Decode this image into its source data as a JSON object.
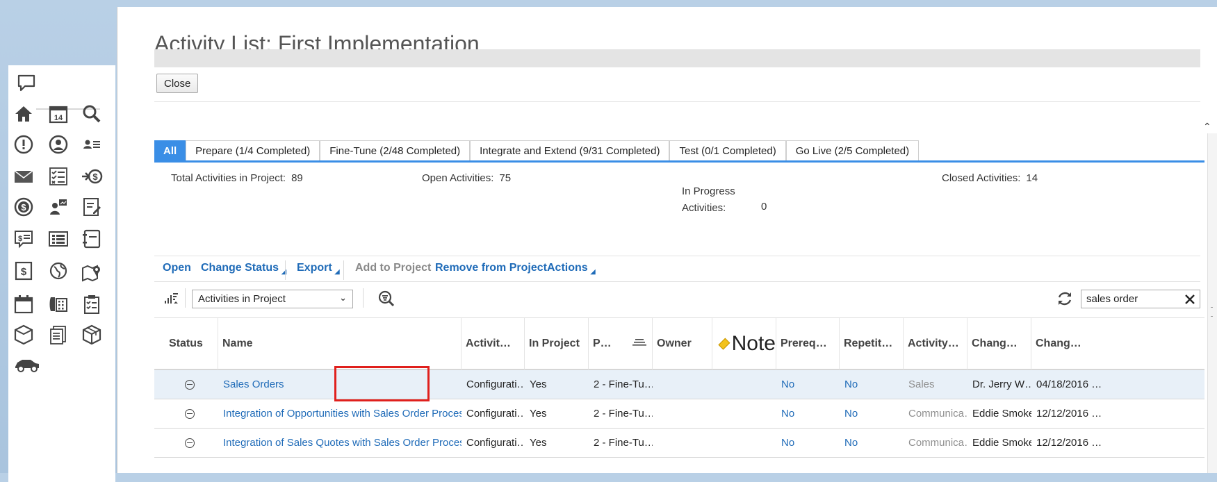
{
  "sidebar": {
    "icons": [
      {
        "name": "chat-icon"
      },
      {
        "name": "home-icon"
      },
      {
        "name": "calendar-icon",
        "label": "14"
      },
      {
        "name": "search-icon"
      },
      {
        "name": "alert-icon"
      },
      {
        "name": "user-profile-icon"
      },
      {
        "name": "contact-list-icon"
      },
      {
        "name": "mail-icon"
      },
      {
        "name": "checklist-icon"
      },
      {
        "name": "payment-icon"
      },
      {
        "name": "money-icon"
      },
      {
        "name": "team-icon"
      },
      {
        "name": "report-edit-icon"
      },
      {
        "name": "invoice-icon"
      },
      {
        "name": "list-icon"
      },
      {
        "name": "notebook-icon"
      },
      {
        "name": "document-dollar-icon"
      },
      {
        "name": "globe-refresh-icon"
      },
      {
        "name": "map-pin-icon"
      },
      {
        "name": "calendar-blank-icon"
      },
      {
        "name": "phone-icon"
      },
      {
        "name": "clipboard-icon"
      },
      {
        "name": "package-icon"
      },
      {
        "name": "documents-icon"
      },
      {
        "name": "cube-icon"
      },
      {
        "name": "car-icon"
      }
    ]
  },
  "page": {
    "title": "Activity List: First Implementation",
    "close_label": "Close"
  },
  "tabs": [
    {
      "label": "All",
      "active": true
    },
    {
      "label": "Prepare (1/4 Completed)"
    },
    {
      "label": "Fine-Tune (2/48 Completed)"
    },
    {
      "label": "Integrate and Extend (9/31 Completed)"
    },
    {
      "label": "Test (0/1 Completed)"
    },
    {
      "label": "Go Live (2/5 Completed)"
    }
  ],
  "stats": {
    "total_label": "Total Activities in Project:",
    "total_value": "89",
    "open_label": "Open Activities:",
    "open_value": "75",
    "inprogress_label_1": "In Progress",
    "inprogress_label_2": "Activities:",
    "inprogress_value": "0",
    "closed_label": "Closed Activities:",
    "closed_value": "14"
  },
  "actions": {
    "open": "Open",
    "change_status": "Change Status",
    "export": "Export",
    "add_to_project": "Add to Project",
    "remove_from_project": "Remove from Project",
    "actions": "Actions"
  },
  "filter": {
    "view_selected": "Activities in Project",
    "search_value": "sales order"
  },
  "table": {
    "headers": {
      "status": "Status",
      "name": "Name",
      "activity": "Activit…",
      "in_project": "In Project",
      "phase": "P…",
      "owner": "Owner",
      "note": "Note",
      "prereq": "Prereq…",
      "repetit": "Repetit…",
      "activity2": "Activity…",
      "chang1": "Chang…",
      "chang2": "Chang…"
    },
    "rows": [
      {
        "name": "Sales Orders",
        "activity": "Configurati…",
        "in_project": "Yes",
        "phase": "2 - Fine-Tu…",
        "owner": "",
        "prereq": "No",
        "repetit": "No",
        "activity2": "Sales",
        "changed_by": "Dr. Jerry W…",
        "changed_on": "04/18/2016 …"
      },
      {
        "name": "Integration of Opportunities with Sales Order Proces…",
        "activity": "Configurati…",
        "in_project": "Yes",
        "phase": "2 - Fine-Tu…",
        "owner": "",
        "prereq": "No",
        "repetit": "No",
        "activity2": "Communica…",
        "changed_by": "Eddie Smoke",
        "changed_on": "12/12/2016 …"
      },
      {
        "name": "Integration of Sales Quotes with Sales Order Proces…",
        "activity": "Configurati…",
        "in_project": "Yes",
        "phase": "2 - Fine-Tu…",
        "owner": "",
        "prereq": "No",
        "repetit": "No",
        "activity2": "Communica…",
        "changed_by": "Eddie Smoke",
        "changed_on": "12/12/2016 …"
      }
    ]
  },
  "colors": {
    "accent": "#3a8ee6",
    "link": "#1f6bb8",
    "highlight": "#e0201d"
  }
}
